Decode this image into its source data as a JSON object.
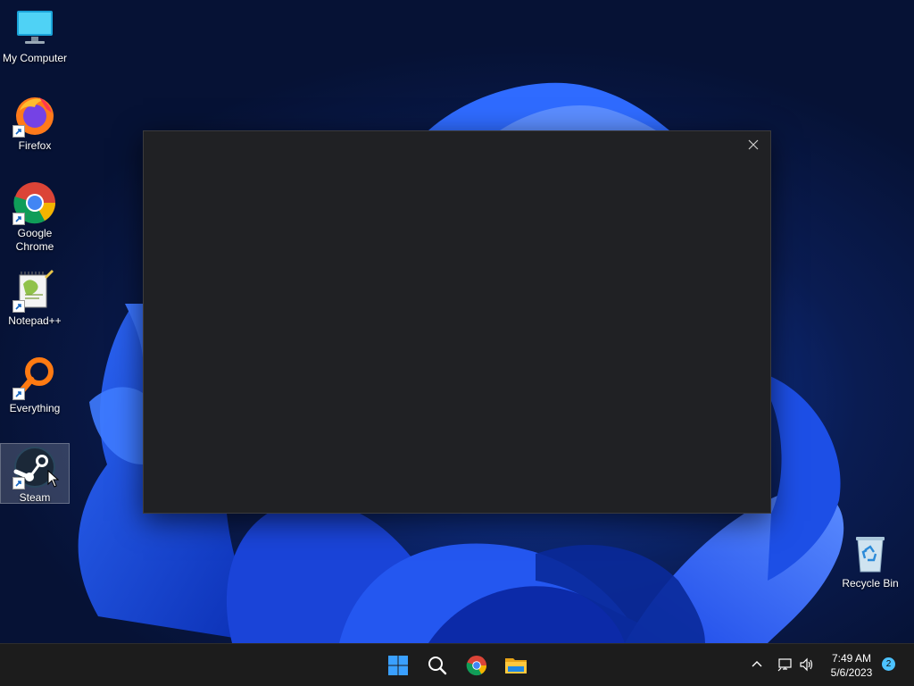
{
  "desktop": {
    "icons": [
      {
        "label": "My Computer",
        "icon": "monitor-icon"
      },
      {
        "label": "Firefox",
        "icon": "firefox-icon"
      },
      {
        "label": "Google Chrome",
        "icon": "chrome-icon"
      },
      {
        "label": "Notepad++",
        "icon": "notepadpp-icon"
      },
      {
        "label": "Everything",
        "icon": "everything-search-icon"
      },
      {
        "label": "Steam",
        "icon": "steam-icon",
        "selected": true
      }
    ],
    "recycle_bin": {
      "label": "Recycle Bin",
      "icon": "recycle-bin-icon"
    }
  },
  "dialog": {
    "close_icon": "close-icon",
    "background": "#202124"
  },
  "taskbar": {
    "apps": [
      {
        "name": "Start",
        "icon": "windows-start-icon"
      },
      {
        "name": "Search",
        "icon": "search-icon"
      },
      {
        "name": "Google Chrome",
        "icon": "chrome-icon"
      },
      {
        "name": "File Explorer",
        "icon": "folder-icon"
      }
    ],
    "tray": {
      "overflow_icon": "chevron-up-icon",
      "network_icon": "network-icon",
      "volume_icon": "volume-icon"
    },
    "clock": {
      "time": "7:49 AM",
      "date": "5/6/2023"
    },
    "notification_count": "2"
  },
  "colors": {
    "accent_blue": "#0078d4",
    "wallpaper_dark": "#08132e",
    "wallpaper_bloom": "#1a4fe0",
    "taskbar": "#1c1c1c",
    "badge": "#4cc2ff"
  }
}
